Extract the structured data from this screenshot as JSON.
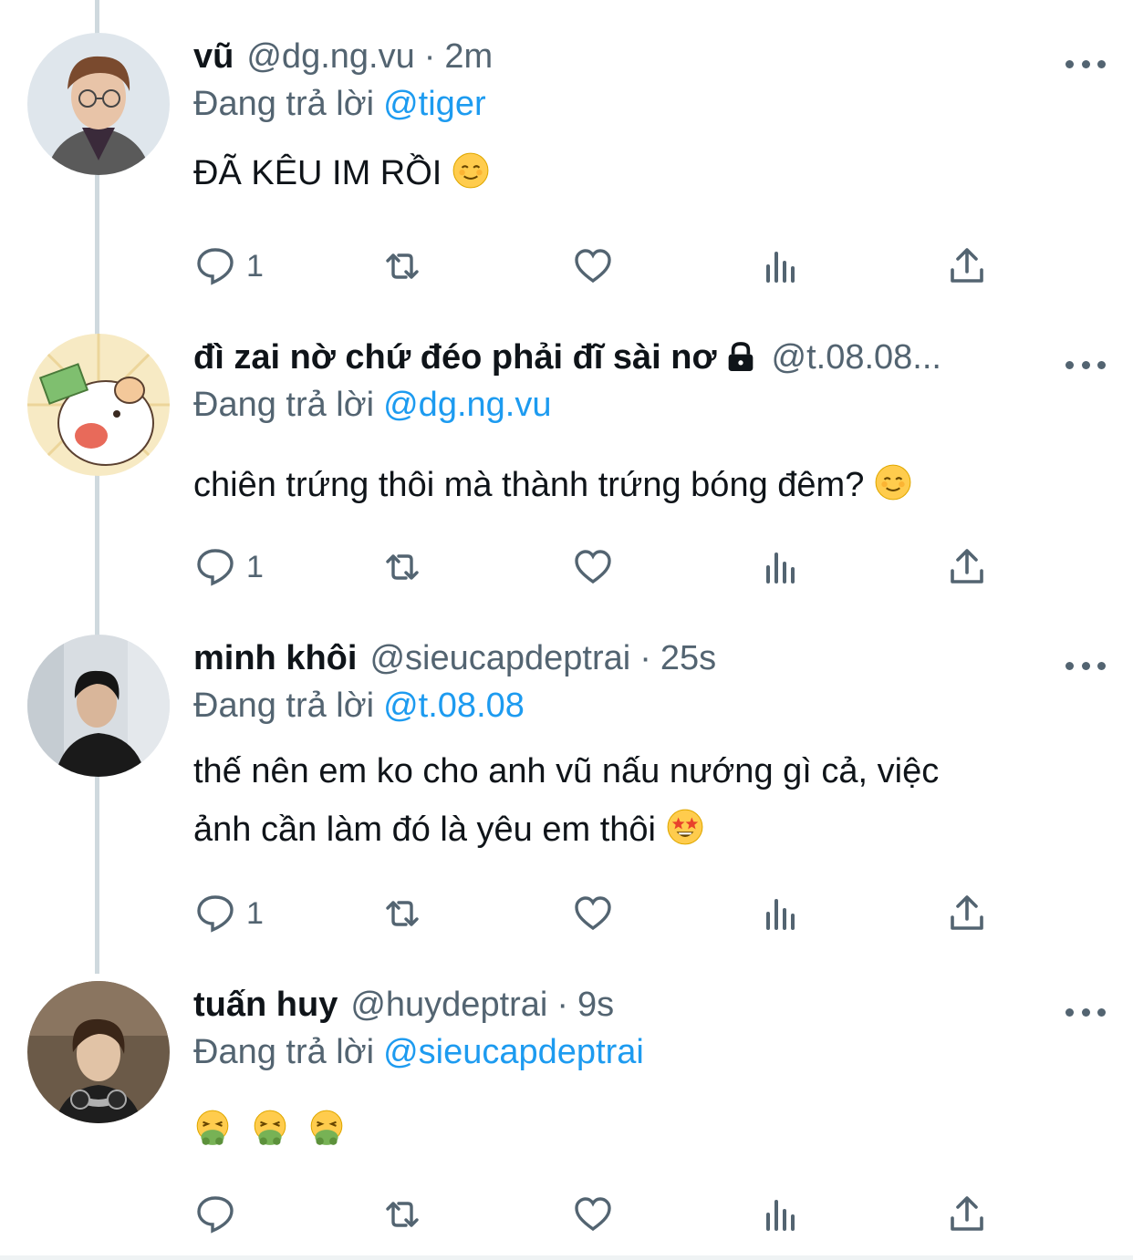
{
  "tweets": [
    {
      "name": "vũ",
      "handle": "@dg.ng.vu",
      "separator": "·",
      "time": "2m",
      "reply_prefix": "Đang trả lời",
      "reply_to": "@tiger",
      "text": "ĐÃ KÊU IM RỒI",
      "emoji": "relieved-face",
      "reply_count": "1",
      "avatar": "man-with-glasses-avatar"
    },
    {
      "name": "đì zai nờ chứ đéo phải đĩ sài nơ",
      "handle": "@t.08.08...",
      "separator": "",
      "time": "",
      "reply_prefix": "Đang trả lời",
      "reply_to": "@dg.ng.vu",
      "text": "chiên trứng thôi mà thành trứng bóng đêm?",
      "emoji": "relieved-face",
      "reply_count": "1",
      "avatar": "cartoon-bear-avatar",
      "protected": true
    },
    {
      "name": "minh khôi",
      "handle": "@sieucapdeptrai",
      "separator": "·",
      "time": "25s",
      "reply_prefix": "Đang trả lời",
      "reply_to": "@t.08.08",
      "text_line1": "thế nên em ko cho anh vũ nấu nướng gì cả, việc",
      "text_line2": "ảnh cần làm đó là yêu em thôi",
      "emoji": "star-struck-face",
      "reply_count": "1",
      "avatar": "man-in-black-avatar"
    },
    {
      "name": "tuấn huy",
      "handle": "@huydeptrai",
      "separator": "·",
      "time": "9s",
      "reply_prefix": "Đang trả lời",
      "reply_to": "@sieucapdeptrai",
      "text": "",
      "emoji": "vomiting-face",
      "reply_count": "",
      "avatar": "man-with-headphones-avatar"
    }
  ],
  "colors": {
    "text": "#0f1419",
    "secondary": "#536471",
    "link": "#1d9bf0",
    "thread_line": "#cfd9de"
  }
}
